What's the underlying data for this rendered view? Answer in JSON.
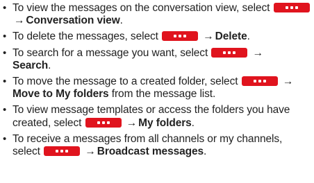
{
  "bullets": [
    {
      "before": "To view the messages on the conversation view, select",
      "button_icon": "more-options-icon",
      "arrow": "→",
      "bold": "Conversation view",
      "after": "."
    },
    {
      "before": "To delete the messages, select",
      "button_icon": "more-options-icon",
      "arrow": "→",
      "bold": "Delete",
      "after": "."
    },
    {
      "before": "To search for a message you want, select",
      "button_icon": "more-options-icon",
      "arrow": "→",
      "bold": "Search",
      "after": "."
    },
    {
      "before": "To move the message to a created folder, select",
      "button_icon": "more-options-icon",
      "arrow": "→",
      "bold": "Move to My folders",
      "after": " from the message list."
    },
    {
      "before": "To view message templates or access the folders you have created, select",
      "button_icon": "more-options-icon",
      "arrow": "→",
      "bold": "My folders",
      "after": "."
    },
    {
      "before": "To receive a messages from all channels or my channels, select",
      "button_icon": "more-options-icon",
      "arrow": "→",
      "bold": "Broadcast messages",
      "after": "."
    }
  ],
  "colors": {
    "button": "#e0141e",
    "text": "#222222"
  }
}
